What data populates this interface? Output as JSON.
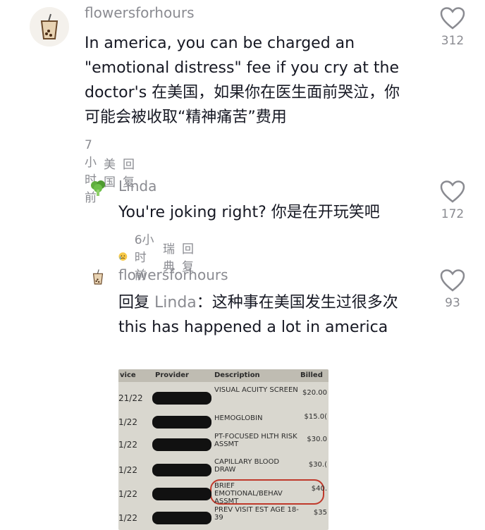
{
  "comments": [
    {
      "username": "flowersforhours",
      "text": "In america, you can be charged an \"emotional distress\" fee if you cry at the doctor's 在美国，如果你在医生面前哭泣，你可能会被收取“精神痛苦”费用",
      "time": "7小时前",
      "location": "美国",
      "reply": "回复",
      "likes": "312"
    },
    {
      "username": "Linda",
      "text": "You're joking right? 你是在开玩笑吧",
      "time": "6小时前",
      "location": "瑞典",
      "reply": "回复",
      "likes": "172"
    },
    {
      "username": "flowersforhours",
      "reply_prefix": "回复",
      "mention": "Linda",
      "text": "：这种事在美国发生过很多次 this has happened a lot in america",
      "likes": "93"
    }
  ],
  "receipt": {
    "headers": [
      "vice",
      "Provider",
      "Description",
      "Billed"
    ],
    "rows": [
      {
        "date": "21/22",
        "desc": "VISUAL ACUITY SCREEN",
        "amount": "$20.00"
      },
      {
        "date": "1/22",
        "desc": "HEMOGLOBIN",
        "amount": "$15.0("
      },
      {
        "date": "1/22",
        "desc": "PT-FOCUSED HLTH RISK ASSMT",
        "amount": "$30.0"
      },
      {
        "date": "1/22",
        "desc": "CAPILLARY BLOOD DRAW",
        "amount": "$30.("
      },
      {
        "date": "1/22",
        "desc": "BRIEF EMOTIONAL/BEHAV ASSMT",
        "amount": "$40."
      },
      {
        "date": "1/22",
        "desc": "PREV VISIT EST AGE 18-39",
        "amount": "$35"
      }
    ]
  },
  "colors": {
    "text": "#161823",
    "muted": "#8a8b91",
    "highlight": "#c0392b"
  },
  "icons": {
    "like": "heart-outline-icon",
    "avatar1": "bubble-tea-icon",
    "avatar2": "broccoli-icon",
    "emoji": "crying-face-icon"
  }
}
